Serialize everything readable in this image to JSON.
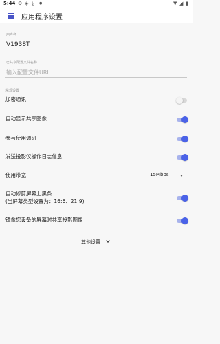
{
  "status_bar": {
    "time": "5:44",
    "icons": [
      "settings-icon",
      "shield-icon",
      "download-icon",
      "dot-icon",
      "wifi-icon",
      "signal-icon",
      "battery-icon"
    ]
  },
  "app_bar": {
    "title": "应用程序设置",
    "menu_icon": "menu-icon"
  },
  "username": {
    "label": "用户名",
    "value": "V1938T"
  },
  "shared_config_url": {
    "label": "已共享配置文件名称",
    "placeholder": "输入配置文件URL"
  },
  "section_header": "常规设置",
  "settings": [
    {
      "label": "加密通讯",
      "on": false
    },
    {
      "label": "自动显示共享图像",
      "on": true
    },
    {
      "label": "参与使用调研",
      "on": true
    },
    {
      "label": "发送投影仪操作日志信息",
      "on": true
    },
    {
      "label": "自动修剪屏幕上黑条",
      "sublabel": "(当屏幕类型设置为：16:6、21:9)",
      "on": true
    },
    {
      "label": "镜像您设备的屏幕时共享投影图像",
      "on": true
    }
  ],
  "bandwidth": {
    "label": "使用带宽",
    "value": "15Mbps"
  },
  "more_settings": {
    "label": "其他设置",
    "icon": "chevron-down-icon"
  },
  "colors": {
    "accent": "#4a62e8",
    "accent_track": "#a8b3ec",
    "background": "#f7f7f7"
  }
}
